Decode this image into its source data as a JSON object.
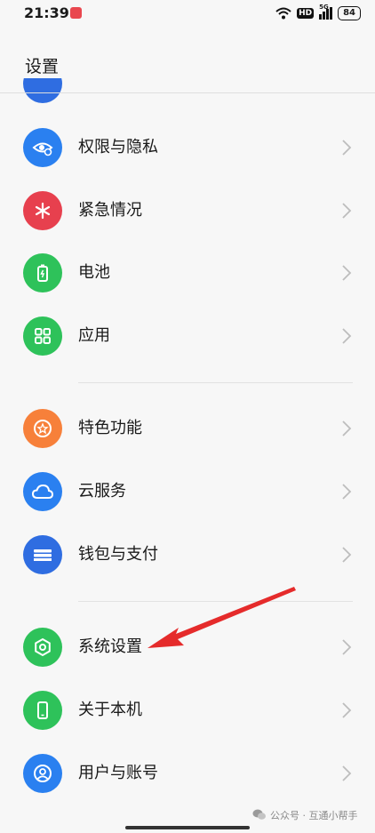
{
  "status_bar": {
    "time": "21:39",
    "hd": "HD",
    "network": "5G",
    "battery": "84"
  },
  "page": {
    "title": "设置"
  },
  "settings_items": [
    {
      "label": "权限与隐私",
      "icon": "privacy-eye-icon",
      "color": "#2a80f0"
    },
    {
      "label": "紧急情况",
      "icon": "emergency-asterisk-icon",
      "color": "#e7404e"
    },
    {
      "label": "电池",
      "icon": "battery-icon",
      "color": "#2ec25a"
    },
    {
      "label": "应用",
      "icon": "apps-grid-icon",
      "color": "#2ec25a"
    },
    {
      "label": "特色功能",
      "icon": "star-circle-icon",
      "color": "#f7803a"
    },
    {
      "label": "云服务",
      "icon": "cloud-icon",
      "color": "#2a80f0"
    },
    {
      "label": "钱包与支付",
      "icon": "wallet-icon",
      "color": "#2f6de1"
    },
    {
      "label": "系统设置",
      "icon": "hexagon-gear-icon",
      "color": "#2ec25a"
    },
    {
      "label": "关于本机",
      "icon": "phone-icon",
      "color": "#2ec25a"
    },
    {
      "label": "用户与账号",
      "icon": "user-account-icon",
      "color": "#2a80f0"
    }
  ],
  "annotation": {
    "arrow_color": "#e52b2b"
  },
  "watermark": {
    "text": "公众号 · 互通小帮手"
  }
}
